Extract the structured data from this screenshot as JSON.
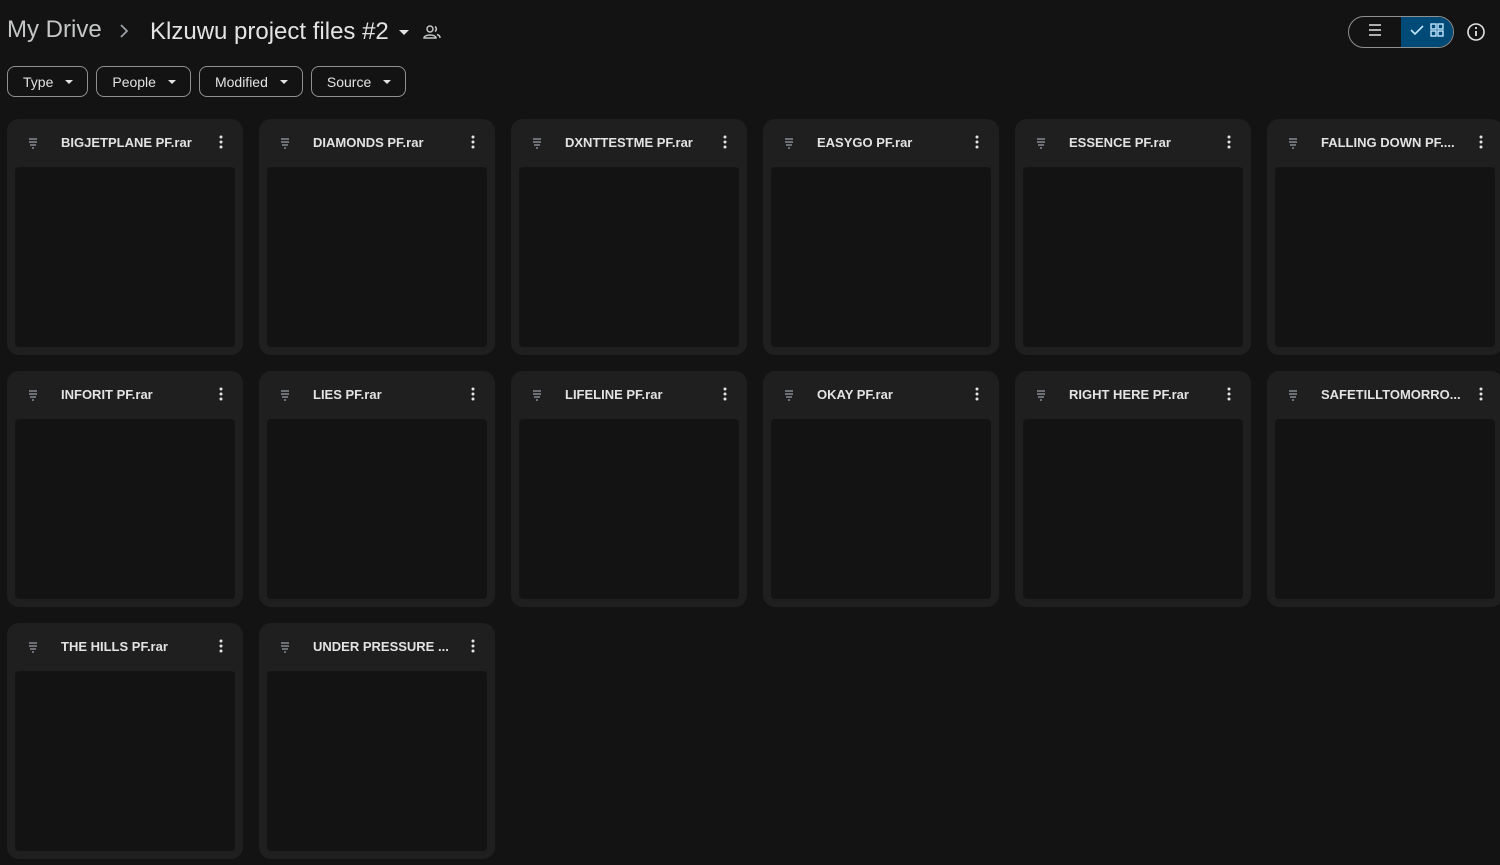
{
  "breadcrumb": {
    "root": "My Drive",
    "current": "Klzuwu project files #2"
  },
  "icons": {
    "separator": "chevron-right-icon",
    "shared": "people-icon",
    "list_view": "list-view-icon",
    "grid_view": "grid-view-icon",
    "info": "info-icon",
    "file": "archive-file-icon",
    "more": "more-vert-icon"
  },
  "filters": [
    {
      "label": "Type"
    },
    {
      "label": "People"
    },
    {
      "label": "Modified"
    },
    {
      "label": "Source"
    }
  ],
  "files": [
    {
      "name": "BIGJETPLANE PF.rar"
    },
    {
      "name": "DIAMONDS PF.rar"
    },
    {
      "name": "DXNTTESTME PF.rar"
    },
    {
      "name": "EASYGO PF.rar"
    },
    {
      "name": "ESSENCE PF.rar"
    },
    {
      "name": "FALLING DOWN PF...."
    },
    {
      "name": "INFORIT PF.rar"
    },
    {
      "name": "LIES PF.rar"
    },
    {
      "name": "LIFELINE PF.rar"
    },
    {
      "name": "OKAY PF.rar"
    },
    {
      "name": "RIGHT HERE PF.rar"
    },
    {
      "name": "SAFETILLTOMORRO..."
    },
    {
      "name": "THE HILLS PF.rar"
    },
    {
      "name": "UNDER PRESSURE ..."
    }
  ],
  "colors": {
    "background": "#131314",
    "card": "#1f1f1f",
    "active_toggle": "#004a77",
    "text": "#e3e3e3"
  }
}
